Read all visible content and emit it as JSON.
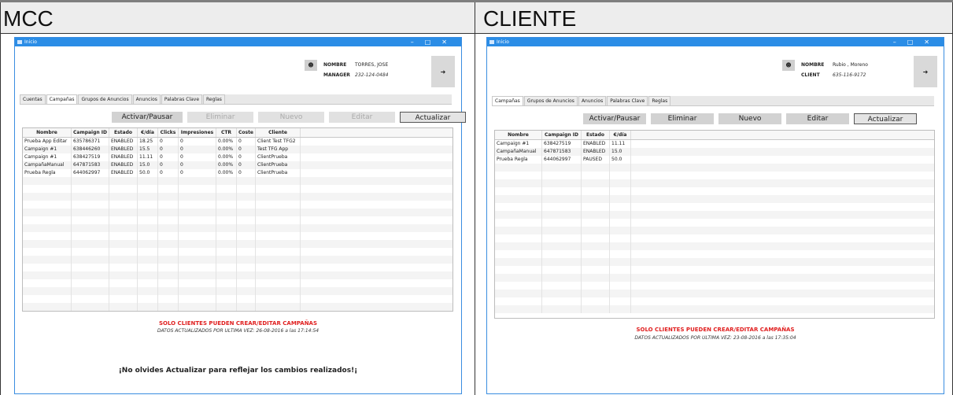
{
  "headers": {
    "left": "MCC",
    "right": "CLIENTE"
  },
  "mcc": {
    "window_title": "Inicio",
    "user": {
      "name_label": "NOMBRE",
      "name": "TORRES, JOSE",
      "role_label": "MANAGER",
      "phone": "232-124-0484"
    },
    "tabs": [
      "Cuentas",
      "Campañas",
      "Grupos de Anuncios",
      "Anuncios",
      "Palabras Clave",
      "Reglas"
    ],
    "selected_tab": 1,
    "buttons": {
      "toggle": "Activar/Pausar",
      "delete": "Eliminar",
      "new": "Nuevo",
      "edit": "Editar",
      "refresh": "Actualizar"
    },
    "columns": [
      "Nombre",
      "Campaign ID",
      "Estado",
      "€/día",
      "Clicks",
      "Impresiones",
      "CTR",
      "Coste",
      "Cliente"
    ],
    "rows": [
      [
        "Prueba App Editar",
        "635786371",
        "ENABLED",
        "18.25",
        "0",
        "0",
        "0.00%",
        "0",
        "Client Test TFG2"
      ],
      [
        "Campaign #1",
        "638446260",
        "ENABLED",
        "15.5",
        "0",
        "0",
        "0.00%",
        "0",
        "Test TFG App"
      ],
      [
        "Campaign #1",
        "638427519",
        "ENABLED",
        "11.11",
        "0",
        "0",
        "0.00%",
        "0",
        "ClientPrueba"
      ],
      [
        "CampañaManual",
        "647871583",
        "ENABLED",
        "15.0",
        "0",
        "0",
        "0.00%",
        "0",
        "ClientPrueba"
      ],
      [
        "Prueba Regla",
        "644062997",
        "ENABLED",
        "50.0",
        "0",
        "0",
        "0.00%",
        "0",
        "ClientPrueba"
      ]
    ],
    "warning": "SOLO CLIENTES PUEDEN CREAR/EDITAR CAMPAÑAS",
    "updated": "DATOS ACTUALIZADOS POR ULTIMA VEZ: 26-08-2016 a las 17:14:54",
    "reminder": "¡No olvides Actualizar para reflejar los cambios realizados!¡"
  },
  "cliente": {
    "window_title": "Inicio",
    "user": {
      "name_label": "NOMBRE",
      "name": "Rubio , Moreno",
      "role_label": "CLIENT",
      "phone": "635-116-9172"
    },
    "tabs": [
      "Campañas",
      "Grupos de Anuncios",
      "Anuncios",
      "Palabras Clave",
      "Reglas"
    ],
    "selected_tab": 0,
    "buttons": {
      "toggle": "Activar/Pausar",
      "delete": "Eliminar",
      "new": "Nuevo",
      "edit": "Editar",
      "refresh": "Actualizar"
    },
    "columns": [
      "Nombre",
      "Campaign ID",
      "Estado",
      "€/día"
    ],
    "rows": [
      [
        "Campaign #1",
        "638427519",
        "ENABLED",
        "11.11"
      ],
      [
        "CampañaManual",
        "647871583",
        "ENABLED",
        "15.0"
      ],
      [
        "Prueba Regla",
        "644062997",
        "PAUSED",
        "50.0"
      ]
    ],
    "warning": "SOLO CLIENTES PUEDEN CREAR/EDITAR CAMPAÑAS",
    "updated": "DATOS ACTUALIZADOS POR ULTIMA VEZ: 23-08-2016 a las 17:35:04"
  },
  "icons": {
    "user": "user-icon",
    "logout": "logout-icon",
    "app": "app-icon",
    "window_controls": "window-controls"
  }
}
